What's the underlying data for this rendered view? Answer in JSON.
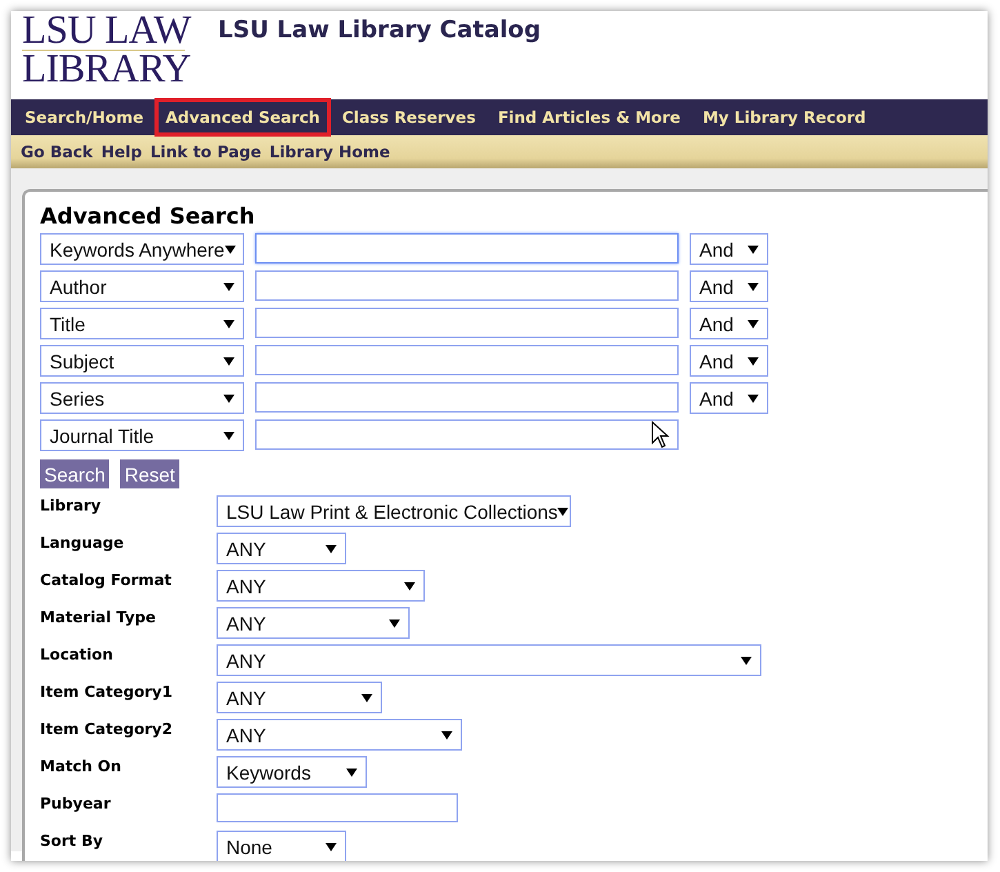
{
  "logo": {
    "line_1": "LSU LAW",
    "line_2": "LIBRARY"
  },
  "site_title": "LSU Law Library Catalog",
  "main_nav": [
    {
      "label": "Search/Home",
      "selected": false
    },
    {
      "label": "Advanced Search",
      "selected": true
    },
    {
      "label": "Class Reserves",
      "selected": false
    },
    {
      "label": "Find Articles & More",
      "selected": false
    },
    {
      "label": "My Library Record",
      "selected": false
    }
  ],
  "sub_nav": [
    "Go Back",
    "Help",
    "Link to Page",
    "Library Home"
  ],
  "form": {
    "title": "Advanced Search",
    "criteria": [
      {
        "field": "Keywords Anywhere",
        "focused": true,
        "operator": "And"
      },
      {
        "field": "Author",
        "focused": false,
        "operator": "And"
      },
      {
        "field": "Title",
        "focused": false,
        "operator": "And"
      },
      {
        "field": "Subject",
        "focused": false,
        "operator": "And"
      },
      {
        "field": "Series",
        "focused": false,
        "operator": "And"
      },
      {
        "field": "Journal Title",
        "focused": false
      }
    ],
    "buttons": [
      "Search",
      "Reset"
    ],
    "filters": [
      {
        "label": "Library",
        "kind": "select",
        "value": "LSU Law Print & Electronic Collections"
      },
      {
        "label": "Language",
        "kind": "select",
        "value": "ANY"
      },
      {
        "label": "Catalog Format",
        "kind": "select",
        "value": "ANY"
      },
      {
        "label": "Material Type",
        "kind": "select",
        "value": "ANY"
      },
      {
        "label": "Location",
        "kind": "select",
        "value": "ANY"
      },
      {
        "label": "Item Category1",
        "kind": "select",
        "value": "ANY"
      },
      {
        "label": "Item Category2",
        "kind": "select",
        "value": "ANY"
      },
      {
        "label": "Match On",
        "kind": "select",
        "value": "Keywords"
      },
      {
        "label": "Pubyear",
        "kind": "input"
      },
      {
        "label": "Sort By",
        "kind": "select",
        "value": "None"
      }
    ]
  }
}
